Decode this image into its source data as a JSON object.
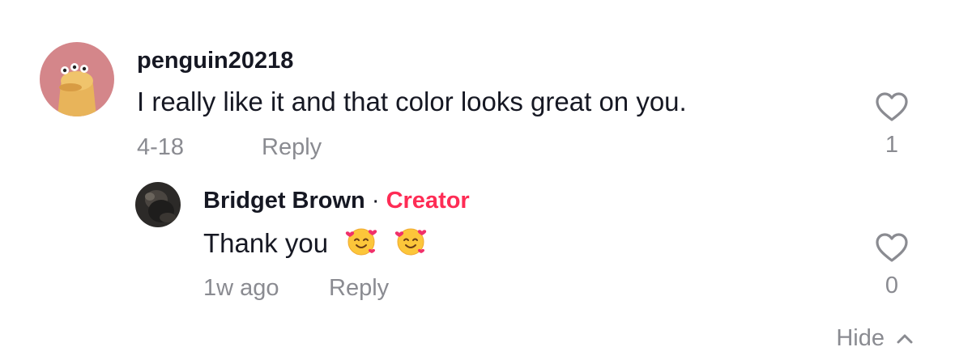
{
  "comment": {
    "username": "penguin20218",
    "text": "I really like it and that color looks great on you.",
    "date": "4-18",
    "reply_label": "Reply",
    "like_count": "1"
  },
  "reply": {
    "username": "Bridget Brown",
    "separator": "·",
    "creator_label": "Creator",
    "text": "Thank you",
    "emojis": [
      "smiling-face-with-hearts",
      "smiling-face-with-hearts"
    ],
    "time": "1w ago",
    "reply_label": "Reply",
    "like_count": "0"
  },
  "hide_label": "Hide",
  "colors": {
    "creator_accent": "#fe2c55",
    "muted_text": "#8a8b91",
    "primary_text": "#161823"
  }
}
